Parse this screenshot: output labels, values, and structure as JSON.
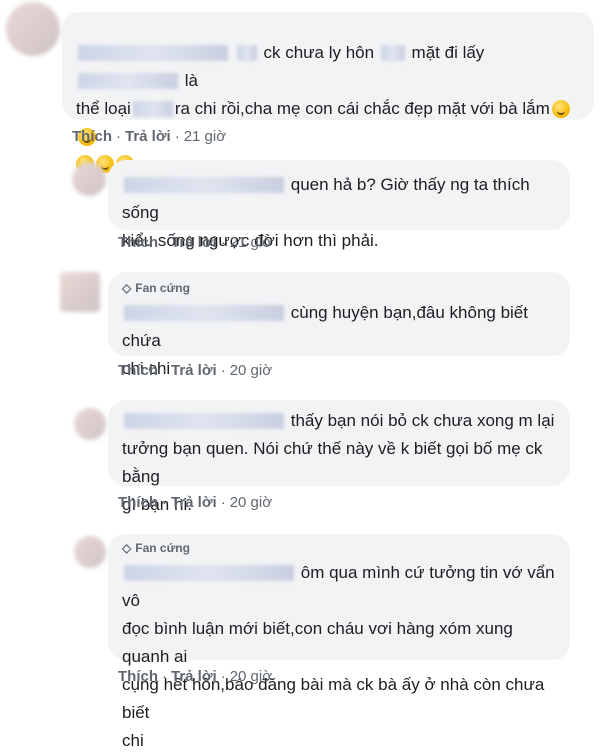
{
  "comments": [
    {
      "badge": "",
      "line1": "ck chưa ly hôn",
      "line1b": "mặt đi lấy",
      "line1c": "là",
      "line2a": "thể loại",
      "line2b": "ra chi rồi,cha mẹ con cái chắc đẹp mặt với bà lắm",
      "emoji_name": "smirk-emoji",
      "like": "Thích",
      "reply": "Trả lời",
      "time": "21 giờ"
    },
    {
      "badge": "",
      "line1": "quen hả b? Giờ thấy ng ta thích sống",
      "line2": "kiểu sống ngược đời hơn thì phải.",
      "like": "Thích",
      "reply": "Trả lời",
      "time": "21 giờ"
    },
    {
      "badge": "Fan cứng",
      "line1": "cùng huyện bạn,đâu không biết chứa",
      "line2": "chi chi",
      "like": "Thích",
      "reply": "Trả lời",
      "time": "20 giờ"
    },
    {
      "badge": "",
      "line1": "thấy bạn nói bỏ ck chưa xong m lại",
      "line2": "tưởng bạn quen. Nói chứ thế này về k biết gọi bố mẹ ck bằng",
      "line3": "gì bạn hi.",
      "like": "Thích",
      "reply": "Trả lời",
      "time": "20 giờ"
    },
    {
      "badge": "Fan cứng",
      "line1": "ôm qua mình cứ tưởng tin vớ vẩn vô",
      "line2": "đọc bình luận mới biết,con cháu vơi hàng xóm xung quanh ai",
      "line3": "cụng hết hồn,báo đăng bài mà ck bà ấy ở nhà còn chưa biết",
      "line4": "chi",
      "like": "Thích",
      "reply": "Trả lời",
      "time": "20 giờ"
    }
  ],
  "badge_icon": "diamond-icon",
  "colors": {
    "bubble": "#f2f3f5",
    "meta": "#606770",
    "text": "#1c1e21"
  }
}
